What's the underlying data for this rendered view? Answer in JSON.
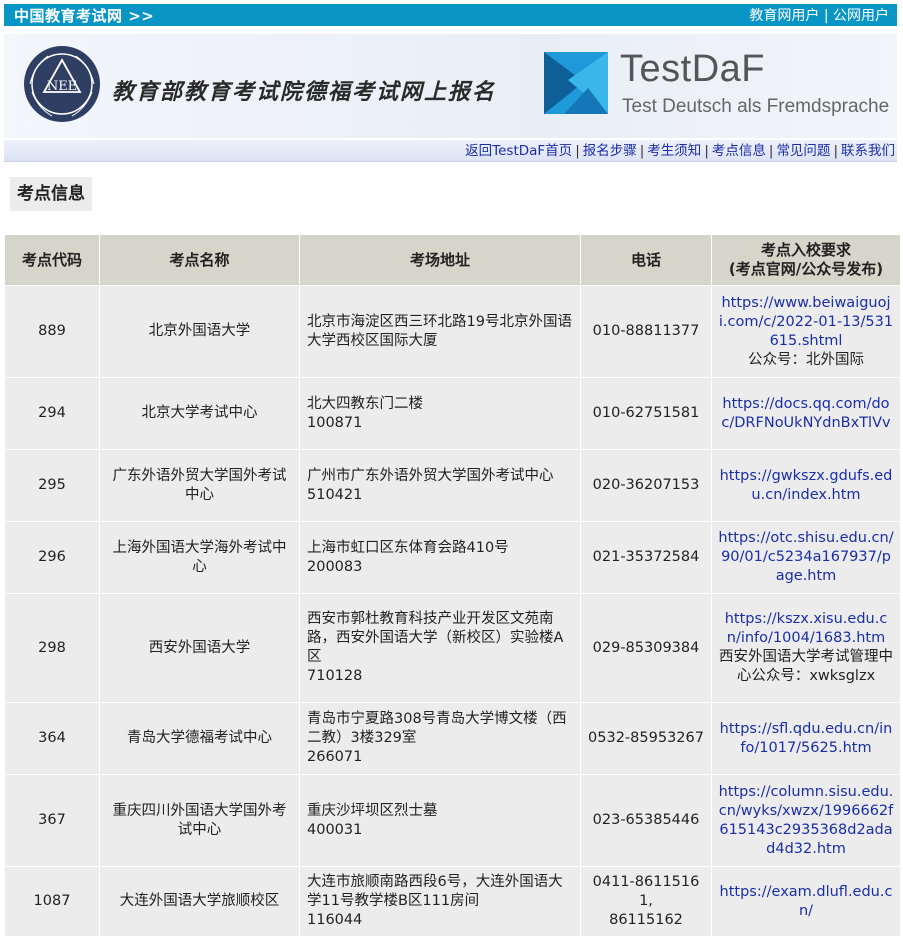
{
  "topbar": {
    "site": "中国教育考试网 >>",
    "user1": "教育网用户",
    "divider": "|",
    "user2": "公网用户"
  },
  "banner": {
    "title": "教育部教育考试院德福考试网上报名",
    "nee_logo_text": "NEE",
    "daf_name": "TestDaF",
    "daf_sub": "Test Deutsch als Fremdsprache"
  },
  "nav": {
    "items": [
      "返回TestDaF首页",
      "报名步骤",
      "考生须知",
      "考点信息",
      "常见问题",
      "联系我们"
    ],
    "separator": "|"
  },
  "page_title": "考点信息",
  "table": {
    "headers": [
      "考点代码",
      "考点名称",
      "考场地址",
      "电话",
      "考点入校要求\n(考点官网/公众号发布)"
    ],
    "rows": [
      {
        "code": "889",
        "name": "北京外国语大学",
        "address": "北京市海淀区西三环北路19号北京外国语大学西校区国际大厦",
        "phone": "010-88811377",
        "url": "https://www.beiwaiguoji.com/c/2022-01-13/531615.shtml",
        "extra": "公众号：北外国际"
      },
      {
        "code": "294",
        "name": "北京大学考试中心",
        "address": "北大四教东门二楼\n100871",
        "phone": "010-62751581",
        "url": "https://docs.qq.com/doc/DRFNoUkNYdnBxTlVv",
        "extra": ""
      },
      {
        "code": "295",
        "name": "广东外语外贸大学国外考试中心",
        "address": "广州市广东外语外贸大学国外考试中心\n510421",
        "phone": "020-36207153",
        "url": "https://gwkszx.gdufs.edu.cn/index.htm",
        "extra": ""
      },
      {
        "code": "296",
        "name": "上海外国语大学海外考试中心",
        "address": "上海市虹口区东体育会路410号\n200083",
        "phone": "021-35372584",
        "url": "https://otc.shisu.edu.cn/90/01/c5234a167937/page.htm",
        "extra": ""
      },
      {
        "code": "298",
        "name": "西安外国语大学",
        "address": "西安市郭杜教育科技产业开发区文苑南路，西安外国语大学（新校区）实验楼A区\n710128",
        "phone": "029-85309384",
        "url": "https://kszx.xisu.edu.cn/info/1004/1683.htm",
        "extra": "西安外国语大学考试管理中心公众号：xwksglzx"
      },
      {
        "code": "364",
        "name": "青岛大学德福考试中心",
        "address": "青岛市宁夏路308号青岛大学博文楼（西二教）3楼329室\n266071",
        "phone": "0532-85953267",
        "url": "https://sfl.qdu.edu.cn/info/1017/5625.htm",
        "extra": ""
      },
      {
        "code": "367",
        "name": "重庆四川外国语大学国外考试中心",
        "address": "重庆沙坪坝区烈士墓\n400031",
        "phone": "023-65385446",
        "url": "https://column.sisu.edu.cn/wyks/xwzx/1996662f615143c2935368d2adad4d32.htm",
        "extra": ""
      },
      {
        "code": "1087",
        "name": "大连外国语大学旅顺校区",
        "address": "大连市旅顺南路西段6号，大连外国语大学11号教学楼B区111房间\n116044",
        "phone": "0411-86115161,\n86115162",
        "url": "https://exam.dlufl.edu.cn/",
        "extra": ""
      }
    ]
  },
  "colors": {
    "topbar_bg": "#0a95c7",
    "header_bg": "#d5d5c9",
    "cell_bg": "#ececec",
    "link": "#1a2ea8"
  }
}
